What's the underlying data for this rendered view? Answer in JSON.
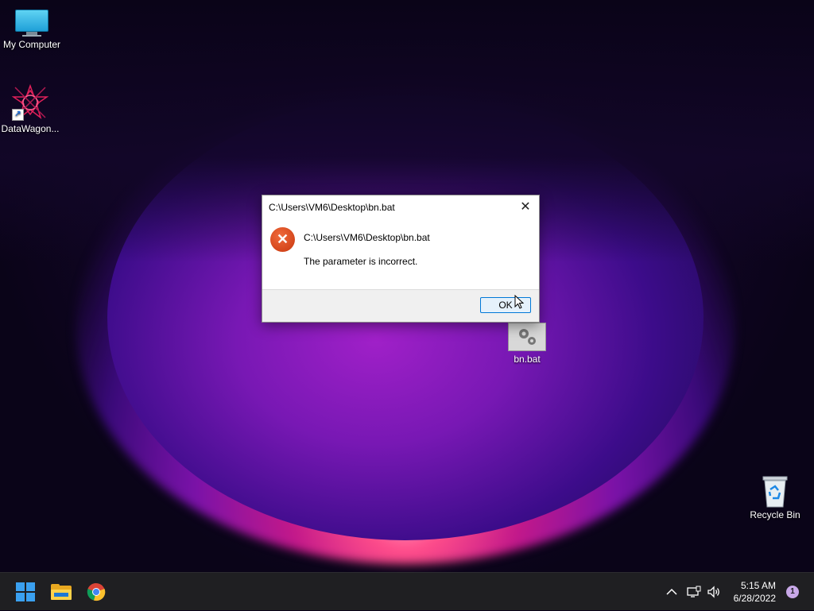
{
  "desktop": {
    "icons": [
      {
        "label": "My Computer",
        "icon": "computer-icon"
      },
      {
        "label": "DataWagon...",
        "icon": "datawagon-icon"
      },
      {
        "label": "bn.bat",
        "icon": "batch-file-icon"
      },
      {
        "label": "Recycle Bin",
        "icon": "recycle-bin-icon"
      }
    ]
  },
  "dialog": {
    "title": "C:\\Users\\VM6\\Desktop\\bn.bat",
    "close_glyph": "✕",
    "icon": "error-icon",
    "icon_glyph": "✕",
    "message_path": "C:\\Users\\VM6\\Desktop\\bn.bat",
    "message_text": "The parameter is incorrect.",
    "ok_label": "OK"
  },
  "taskbar": {
    "apps": [
      {
        "name": "start",
        "icon": "windows-start-icon"
      },
      {
        "name": "file-explorer",
        "icon": "folder-icon"
      },
      {
        "name": "chrome",
        "icon": "chrome-icon"
      }
    ],
    "tray": {
      "chevron_glyph": "^",
      "network_icon": "network-icon",
      "volume_icon": "volume-icon",
      "time": "5:15 AM",
      "date": "6/28/2022",
      "notification_count": "1"
    }
  },
  "colors": {
    "accent": "#0078d7",
    "error": "#d9441a",
    "taskbar": "#1f1f22"
  }
}
